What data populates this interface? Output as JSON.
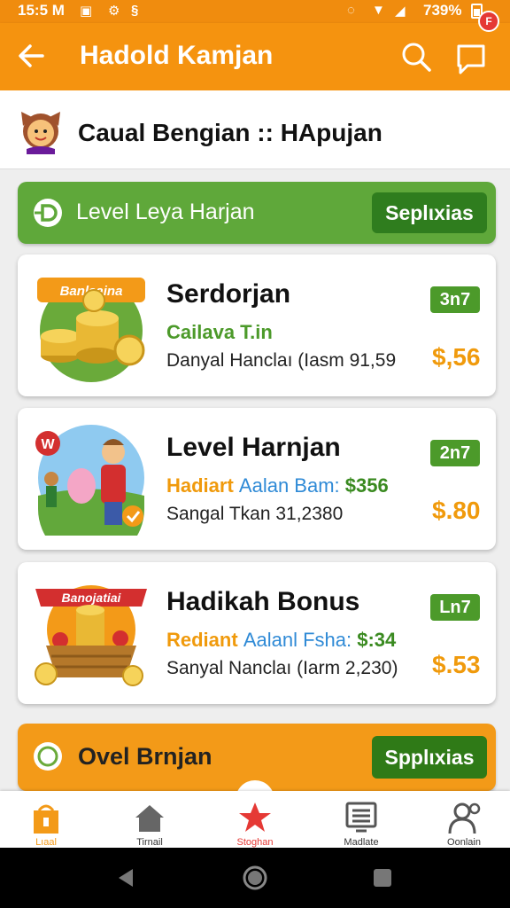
{
  "status_bar": {
    "time": "15:5 M",
    "battery": "739%"
  },
  "app_bar": {
    "title": "Hadold Kamjan",
    "badge": "F"
  },
  "subheader": {
    "name": "Caual Bengian :: HApujan"
  },
  "level_banner": {
    "text": "Level Leya Harjan",
    "button": "Seplιxias"
  },
  "cards": [
    {
      "image_label": "Banlaaina",
      "title": "Serdorjan",
      "subtitle_a": "Cailava T.in",
      "subtitle_b": "",
      "subtitle_c": "",
      "description": "Danyal Hanclaı (Iasm 91,59",
      "tag": "3n7",
      "price": "$,56"
    },
    {
      "image_label": "W",
      "title": "Level Harnjan",
      "subtitle_a": "Hadiart",
      "subtitle_b": "Aalan Bam:",
      "subtitle_c": "$356",
      "description": "Sangal Tkan 31,2380",
      "tag": "2n7",
      "price": "$.80"
    },
    {
      "image_label": "Banojatiai",
      "title": "Hadikah Bonus",
      "subtitle_a": "Rediant",
      "subtitle_b": "Aalanl Fsha:",
      "subtitle_c": "$:34",
      "description": "Sanyal Nanclaı (Iarm 2,230)",
      "tag": "Ln7",
      "price": "$.53"
    }
  ],
  "bottom_banner": {
    "text": "Ovel Brnjan",
    "button": "Spplιxias"
  },
  "bottom_nav": [
    {
      "label": "Lıaal",
      "icon": "shop-icon"
    },
    {
      "label": "Tirnail",
      "icon": "home-icon"
    },
    {
      "label": "Stoghan",
      "icon": "star-icon"
    },
    {
      "label": "Madlate",
      "icon": "list-icon"
    },
    {
      "label": "Oonlain",
      "icon": "profile-icon"
    }
  ],
  "colors": {
    "primary_orange": "#f5930f",
    "green": "#5fa83a",
    "dark_green": "#2f7d1e",
    "price_orange": "#f09a0c",
    "active_red": "#e53935"
  }
}
